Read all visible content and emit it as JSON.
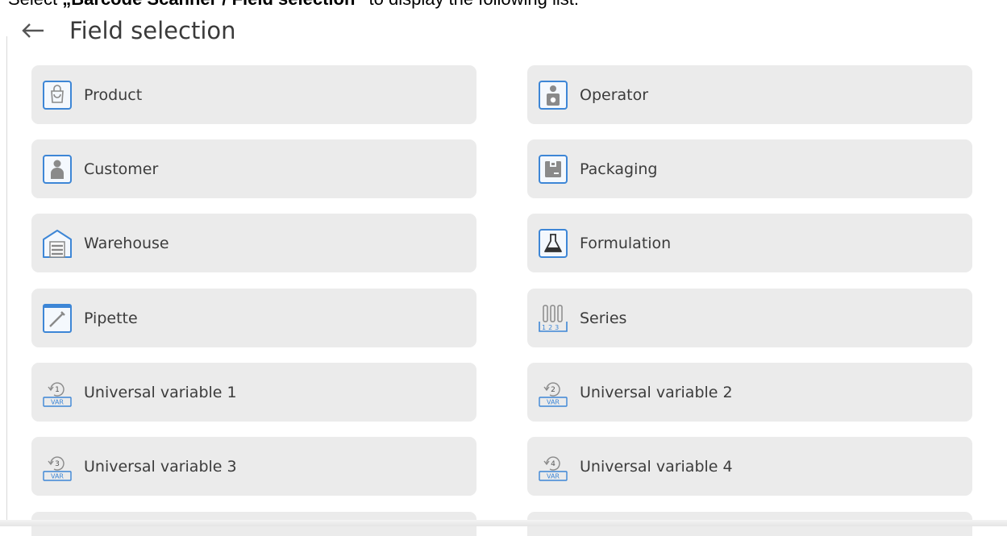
{
  "instruction": {
    "prefix": "Select ",
    "bold": "„Barcode Scanner / Field selection”",
    "suffix": " to display the following list:"
  },
  "header": {
    "title": "Field selection",
    "back_icon": "arrow-left-icon"
  },
  "tiles": [
    {
      "label": "Product",
      "icon": "shopping-bag-icon"
    },
    {
      "label": "Operator",
      "icon": "operator-icon"
    },
    {
      "label": "Customer",
      "icon": "person-icon"
    },
    {
      "label": "Packaging",
      "icon": "package-icon"
    },
    {
      "label": "Warehouse",
      "icon": "warehouse-icon"
    },
    {
      "label": "Formulation",
      "icon": "flask-icon"
    },
    {
      "label": "Pipette",
      "icon": "pipette-icon"
    },
    {
      "label": "Series",
      "icon": "test-tubes-icon"
    },
    {
      "label": "Universal variable 1",
      "icon": "var-1-icon",
      "num": "1",
      "var": "VAR"
    },
    {
      "label": "Universal variable 2",
      "icon": "var-2-icon",
      "num": "2",
      "var": "VAR"
    },
    {
      "label": "Universal variable 3",
      "icon": "var-3-icon",
      "num": "3",
      "var": "VAR"
    },
    {
      "label": "Universal variable 4",
      "icon": "var-4-icon",
      "num": "4",
      "var": "VAR"
    }
  ],
  "colors": {
    "tile_bg": "#ebebeb",
    "icon_blue": "#3d86d6",
    "icon_grey": "#8a8a8a",
    "text": "#3c3c3c"
  }
}
